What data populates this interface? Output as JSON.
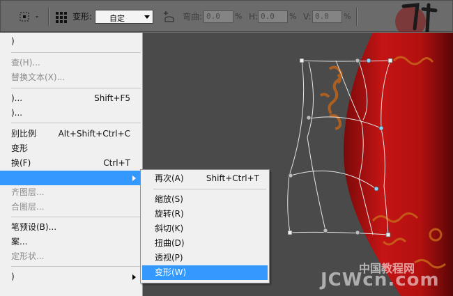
{
  "options_bar": {
    "warp_label": "变形:",
    "warp_style_value": "自定",
    "bend_label": "弯曲:",
    "bend_value": "0.0",
    "bend_unit": "%",
    "h_label": "H:",
    "h_value": "0.0",
    "h_unit": "%",
    "v_label": "V:",
    "v_value": "0.0",
    "v_unit": "%",
    "icons": [
      "reference-point-icon",
      "grid-icon",
      "warp-orientation-icon",
      "cancel-icon",
      "commit-icon"
    ]
  },
  "edit_menu": {
    "items": [
      {
        "label": ")",
        "shortcut": "",
        "disabled": false
      },
      {
        "label": "查(H)...",
        "shortcut": "",
        "disabled": true
      },
      {
        "label": "替换文本(X)...",
        "shortcut": "",
        "disabled": true
      },
      {
        "label": ")...",
        "shortcut": "Shift+F5",
        "disabled": false
      },
      {
        "label": ")...",
        "shortcut": "",
        "disabled": false
      },
      {
        "label": "别比例",
        "shortcut": "Alt+Shift+Ctrl+C",
        "disabled": false
      },
      {
        "label": "变形",
        "shortcut": "",
        "disabled": false
      },
      {
        "label": "换(F)",
        "shortcut": "Ctrl+T",
        "disabled": false
      },
      {
        "label": "",
        "shortcut": "",
        "disabled": false
      },
      {
        "label": "齐图层...",
        "shortcut": "",
        "disabled": true
      },
      {
        "label": "合图层...",
        "shortcut": "",
        "disabled": true
      },
      {
        "label": "笔预设(B)...",
        "shortcut": "",
        "disabled": false
      },
      {
        "label": "案...",
        "shortcut": "",
        "disabled": false
      },
      {
        "label": "定形状...",
        "shortcut": "",
        "disabled": true
      },
      {
        "label": ")",
        "shortcut": "",
        "disabled": false
      }
    ]
  },
  "transform_submenu": {
    "items": [
      {
        "label": "再次(A)",
        "shortcut": "Shift+Ctrl+T"
      },
      {
        "label": "缩放(S)",
        "shortcut": ""
      },
      {
        "label": "旋转(R)",
        "shortcut": ""
      },
      {
        "label": "斜切(K)",
        "shortcut": ""
      },
      {
        "label": "扭曲(D)",
        "shortcut": ""
      },
      {
        "label": "透视(P)",
        "shortcut": ""
      },
      {
        "label": "变形(W)",
        "shortcut": ""
      }
    ]
  },
  "watermark": {
    "text": "JCWcn.com",
    "cn_text": "中国教程网"
  },
  "colors": {
    "menu_bg": "#f0f0f0",
    "highlight": "#3399ff",
    "toolbar_bg": "#6b6b6b",
    "canvas_bg": "#4a4a4a",
    "vase_red": "#b01010",
    "ornament_gold": "#c86a1a"
  }
}
